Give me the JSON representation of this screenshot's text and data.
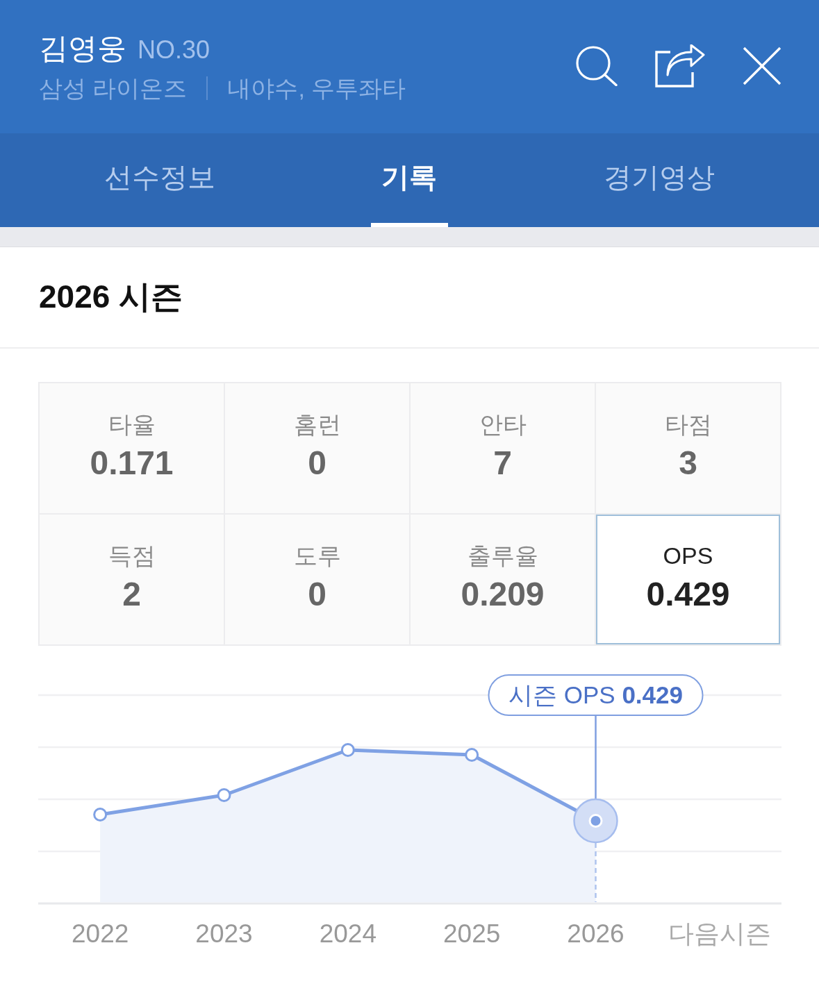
{
  "header": {
    "name": "김영웅",
    "number": "NO.30",
    "team": "삼성 라이온즈",
    "position": "내야수, 우투좌타"
  },
  "actions": [
    {
      "kind": "search"
    },
    {
      "kind": "share"
    },
    {
      "kind": "close"
    }
  ],
  "tabs": [
    {
      "label": "선수정보",
      "selected": false
    },
    {
      "label": "기록",
      "selected": true
    },
    {
      "label": "경기영상",
      "selected": false
    }
  ],
  "season_title": "2026 시즌",
  "stats": [
    {
      "label": "타율",
      "value": "0.171",
      "selected": false
    },
    {
      "label": "홈런",
      "value": "0",
      "selected": false
    },
    {
      "label": "안타",
      "value": "7",
      "selected": false
    },
    {
      "label": "타점",
      "value": "3",
      "selected": false
    },
    {
      "label": "득점",
      "value": "2",
      "selected": false
    },
    {
      "label": "도루",
      "value": "0",
      "selected": false
    },
    {
      "label": "출루율",
      "value": "0.209",
      "selected": false
    },
    {
      "label": "OPS",
      "value": "0.429",
      "selected": true
    }
  ],
  "chart": {
    "callout": "시즌 OPS **0.429**",
    "points": [
      {
        "selected": false
      },
      {
        "selected": false
      },
      {
        "selected": false
      },
      {
        "selected": false
      },
      {
        "selected": true
      }
    ],
    "x_labels": [
      "2022",
      "2023",
      "2024",
      "2025",
      "2026",
      "다음시즌"
    ]
  }
}
